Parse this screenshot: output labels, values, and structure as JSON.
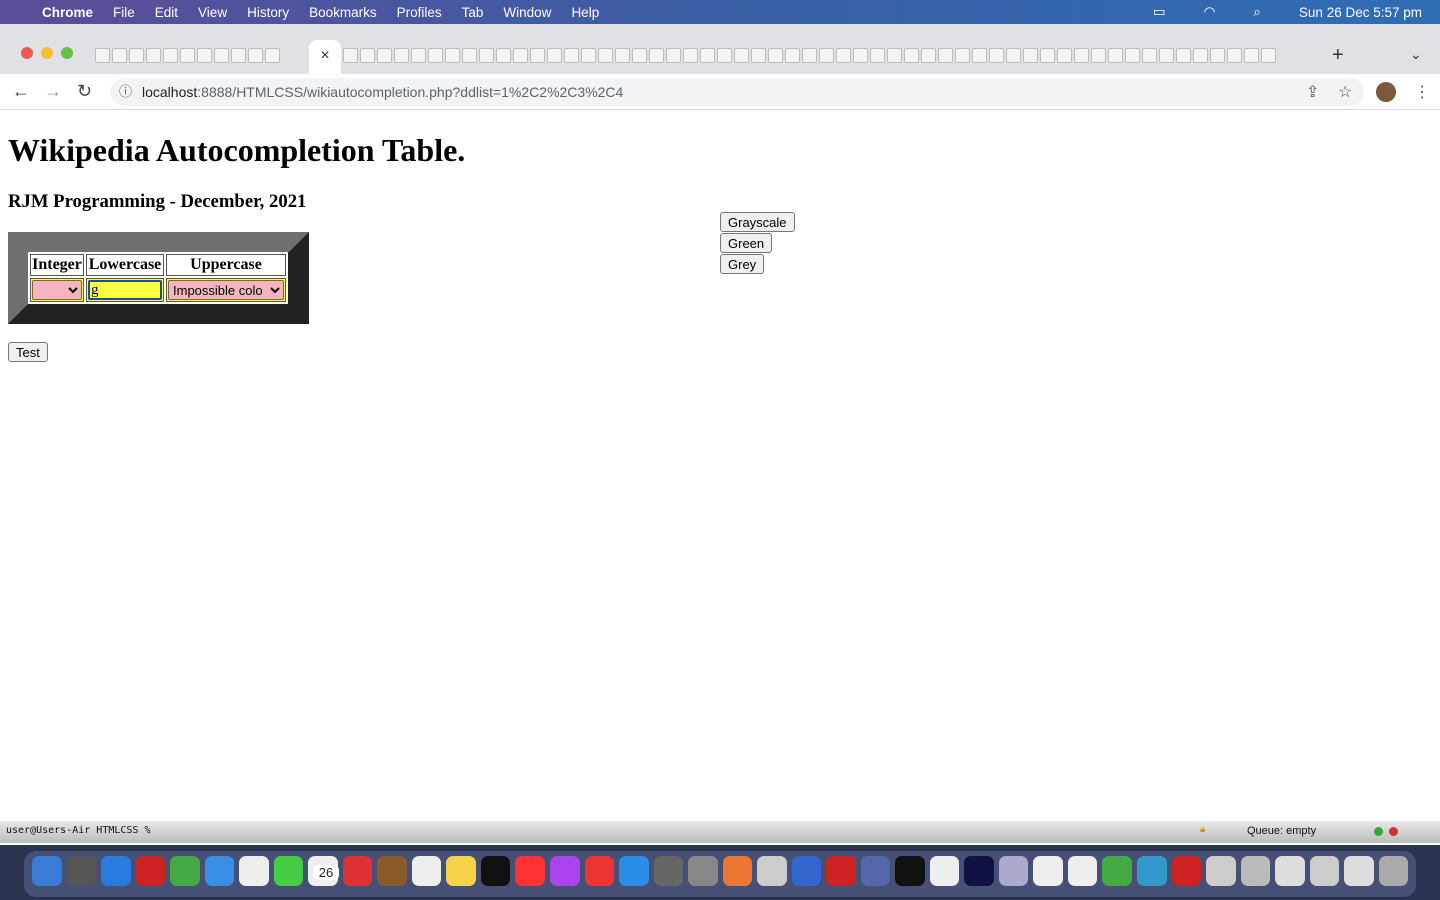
{
  "menubar": {
    "app": "Chrome",
    "items": [
      "File",
      "Edit",
      "View",
      "History",
      "Bookmarks",
      "Profiles",
      "Tab",
      "Window",
      "Help"
    ],
    "datetime": "Sun 26 Dec  5:57 pm"
  },
  "browser": {
    "url_host": "localhost",
    "url_rest": ":8888/HTMLCSS/wikiautocompletion.php?ddlist=1%2C2%2C3%2C4",
    "close_tab": "×",
    "new_tab": "+"
  },
  "page": {
    "title": "Wikipedia Autocompletion Table.",
    "subtitle": "RJM Programming - December, 2021",
    "table": {
      "headers": [
        "Integer",
        "Lowercase",
        "Uppercase"
      ],
      "integer_value": "",
      "lowercase_value": "g",
      "uppercase_value": "Impossible colo"
    },
    "test_button": "Test",
    "color_buttons": [
      "Grayscale",
      "Green",
      "Grey"
    ]
  },
  "terminal": {
    "prompt": "user@Users-Air HTMLCSS % ",
    "queue": "Queue: empty"
  },
  "dock": {
    "calendar_day": "26"
  }
}
